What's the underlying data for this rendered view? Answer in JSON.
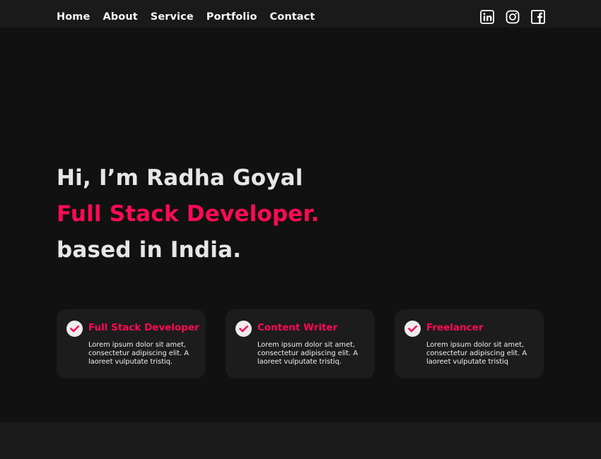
{
  "nav": {
    "links": [
      "Home",
      "About",
      "Service",
      "Portfolio",
      "Contact"
    ],
    "social_icons": [
      "linkedin-icon",
      "instagram-icon",
      "facebook-icon"
    ]
  },
  "hero": {
    "greeting": "Hi, I’m Radha Goyal",
    "role": "Full Stack Developer.",
    "location": "based in India."
  },
  "cards": [
    {
      "title": "Full Stack Developer",
      "text": "Lorem ipsum dolor sit amet, consectetur adipiscing elit. A laoreet vulputate tristiq.",
      "icon": "check-circle-icon"
    },
    {
      "title": "Content Writer",
      "text": "Lorem ipsum dolor sit amet, consectetur adipiscing elit. A laoreet vulputate tristiq.",
      "icon": "check-circle-icon"
    },
    {
      "title": "Freelancer",
      "text": "Lorem ipsum dolor sit amet, consectetur adipiscing elit. A laoreet vulputate tristiq",
      "icon": "check-circle-icon"
    }
  ],
  "colors": {
    "background": "#111111",
    "navbar": "#1a1a1a",
    "accent": "#ff0a54",
    "text": "#e6e6e6",
    "card": "#1c1c1c"
  }
}
